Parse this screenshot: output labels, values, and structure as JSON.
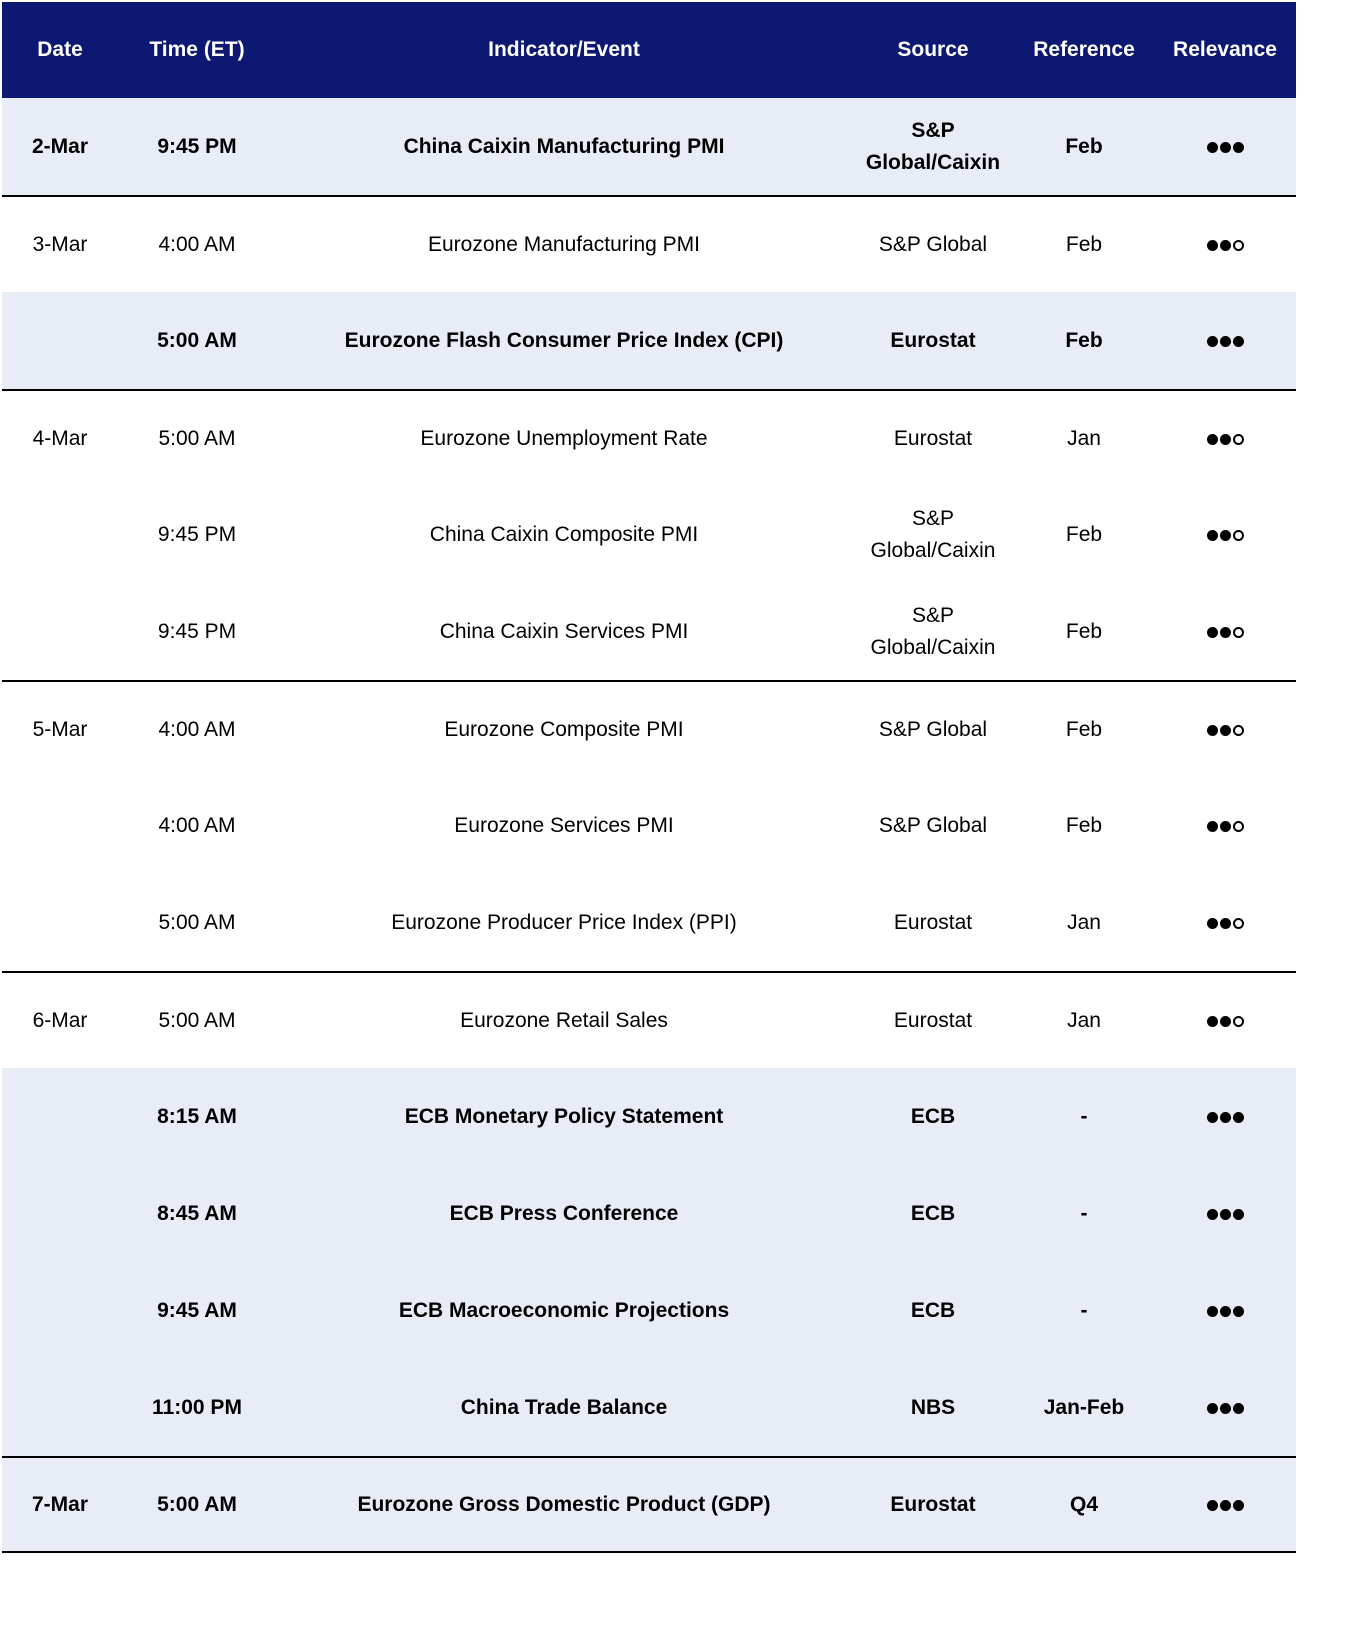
{
  "header": {
    "date": "Date",
    "time": "Time (ET)",
    "indicator": "Indicator/Event",
    "source": "Source",
    "reference": "Reference",
    "relevance": "Relevance"
  },
  "rows": [
    {
      "date": "2-Mar",
      "time": "9:45 PM",
      "indicator": "China Caixin Manufacturing PMI",
      "source": "S&P Global/Caixin",
      "reference": "Feb",
      "relevance": 3,
      "bold": true,
      "highlight": true
    },
    {
      "date": "3-Mar",
      "time": "4:00 AM",
      "indicator": "Eurozone Manufacturing PMI",
      "source": "S&P Global",
      "reference": "Feb",
      "relevance": 2,
      "bold": false,
      "highlight": false
    },
    {
      "date": "",
      "time": "5:00 AM",
      "indicator": "Eurozone Flash Consumer Price Index (CPI)",
      "source": "Eurostat",
      "reference": "Feb",
      "relevance": 3,
      "bold": true,
      "highlight": true
    },
    {
      "date": "4-Mar",
      "time": "5:00 AM",
      "indicator": "Eurozone Unemployment Rate",
      "source": "Eurostat",
      "reference": "Jan",
      "relevance": 2,
      "bold": false,
      "highlight": false
    },
    {
      "date": "",
      "time": "9:45 PM",
      "indicator": "China Caixin Composite PMI",
      "source": "S&P Global/Caixin",
      "reference": "Feb",
      "relevance": 2,
      "bold": false,
      "highlight": false
    },
    {
      "date": "",
      "time": "9:45 PM",
      "indicator": "China Caixin Services PMI",
      "source": "S&P Global/Caixin",
      "reference": "Feb",
      "relevance": 2,
      "bold": false,
      "highlight": false
    },
    {
      "date": "5-Mar",
      "time": "4:00 AM",
      "indicator": "Eurozone Composite PMI",
      "source": "S&P Global",
      "reference": "Feb",
      "relevance": 2,
      "bold": false,
      "highlight": false
    },
    {
      "date": "",
      "time": "4:00 AM",
      "indicator": "Eurozone Services PMI",
      "source": "S&P Global",
      "reference": "Feb",
      "relevance": 2,
      "bold": false,
      "highlight": false
    },
    {
      "date": "",
      "time": "5:00 AM",
      "indicator": "Eurozone Producer Price Index (PPI)",
      "source": "Eurostat",
      "reference": "Jan",
      "relevance": 2,
      "bold": false,
      "highlight": false
    },
    {
      "date": "6-Mar",
      "time": "5:00 AM",
      "indicator": "Eurozone Retail Sales",
      "source": "Eurostat",
      "reference": "Jan",
      "relevance": 2,
      "bold": false,
      "highlight": false
    },
    {
      "date": "",
      "time": "8:15 AM",
      "indicator": "ECB Monetary Policy Statement",
      "source": "ECB",
      "reference": "-",
      "relevance": 3,
      "bold": true,
      "highlight": true
    },
    {
      "date": "",
      "time": "8:45 AM",
      "indicator": "ECB Press Conference",
      "source": "ECB",
      "reference": "-",
      "relevance": 3,
      "bold": true,
      "highlight": true
    },
    {
      "date": "",
      "time": "9:45 AM",
      "indicator": "ECB Macroeconomic Projections",
      "source": "ECB",
      "reference": "-",
      "relevance": 3,
      "bold": true,
      "highlight": true
    },
    {
      "date": "",
      "time": "11:00 PM",
      "indicator": "China Trade Balance",
      "source": "NBS",
      "reference": "Jan-Feb",
      "relevance": 3,
      "bold": true,
      "highlight": true
    },
    {
      "date": "7-Mar",
      "time": "5:00 AM",
      "indicator": "Eurozone Gross Domestic Product (GDP)",
      "source": "Eurostat",
      "reference": "Q4",
      "relevance": 3,
      "bold": true,
      "highlight": true
    }
  ],
  "relevance_max": 3
}
